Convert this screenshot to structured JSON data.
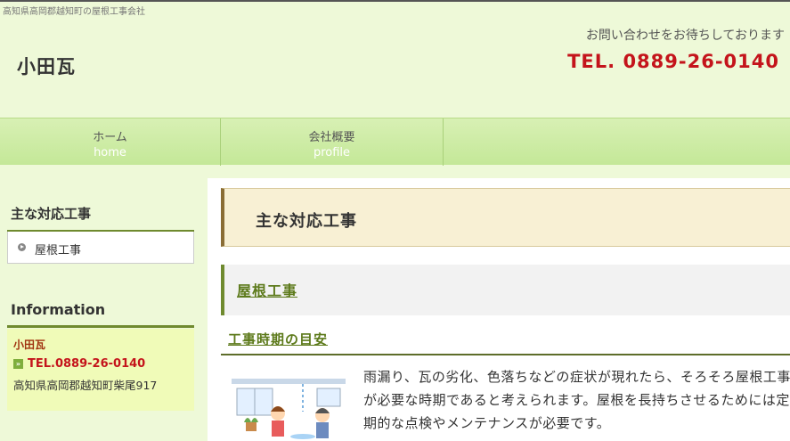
{
  "header": {
    "tagline": "高知県高岡郡越知町の屋根工事会社",
    "site_title": "小田瓦",
    "contact_message": "お問い合わせをお待ちしております",
    "tel": "TEL. 0889-26-0140"
  },
  "nav": {
    "items": [
      {
        "label": "ホーム",
        "sub": "home"
      },
      {
        "label": "会社概要",
        "sub": "profile"
      }
    ]
  },
  "sidebar": {
    "works_heading": "主な対応工事",
    "works_items": [
      {
        "label": "屋根工事"
      }
    ],
    "info_heading": "Information",
    "info": {
      "name": "小田瓦",
      "tel": "TEL.0889-26-0140",
      "address": "高知県高岡郡越知町柴尾917"
    }
  },
  "main": {
    "page_heading": "主な対応工事",
    "section_heading": "屋根工事",
    "sub_heading": "工事時期の目安",
    "body_text": "雨漏り、瓦の劣化、色落ちなどの症状が現れたら、そろそろ屋根工事が必要な時期であると考えられます。屋根を長持ちさせるためには定期的な点検やメンテナンスが必要です。"
  },
  "colors": {
    "accent_red": "#c4141b",
    "nav_green": "#c4e898",
    "heading_brown": "#8a6d35",
    "link_green": "#5d7a1b"
  }
}
